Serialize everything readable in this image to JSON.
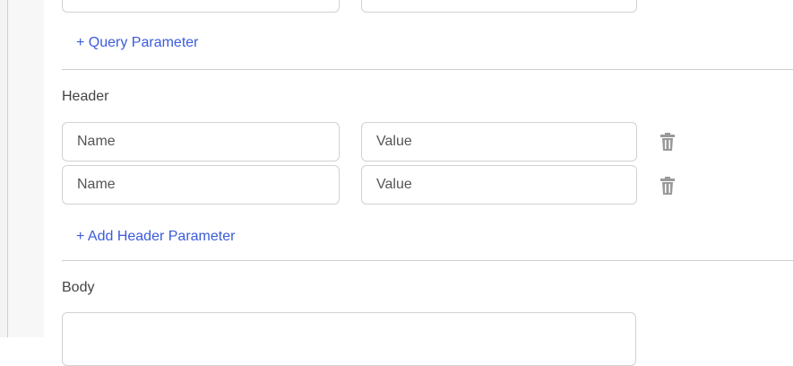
{
  "query": {
    "add_label": "+ Query Parameter"
  },
  "header": {
    "section_label": "Header",
    "rows": [
      {
        "name_placeholder": "Name",
        "value_placeholder": "Value"
      },
      {
        "name_placeholder": "Name",
        "value_placeholder": "Value"
      }
    ],
    "add_label": "+ Add Header Parameter",
    "delete_icon": "trash-icon"
  },
  "body": {
    "section_label": "Body"
  },
  "colors": {
    "link": "#3b5bdb",
    "border": "#d2d2d2",
    "divider": "#cfcfcf"
  }
}
